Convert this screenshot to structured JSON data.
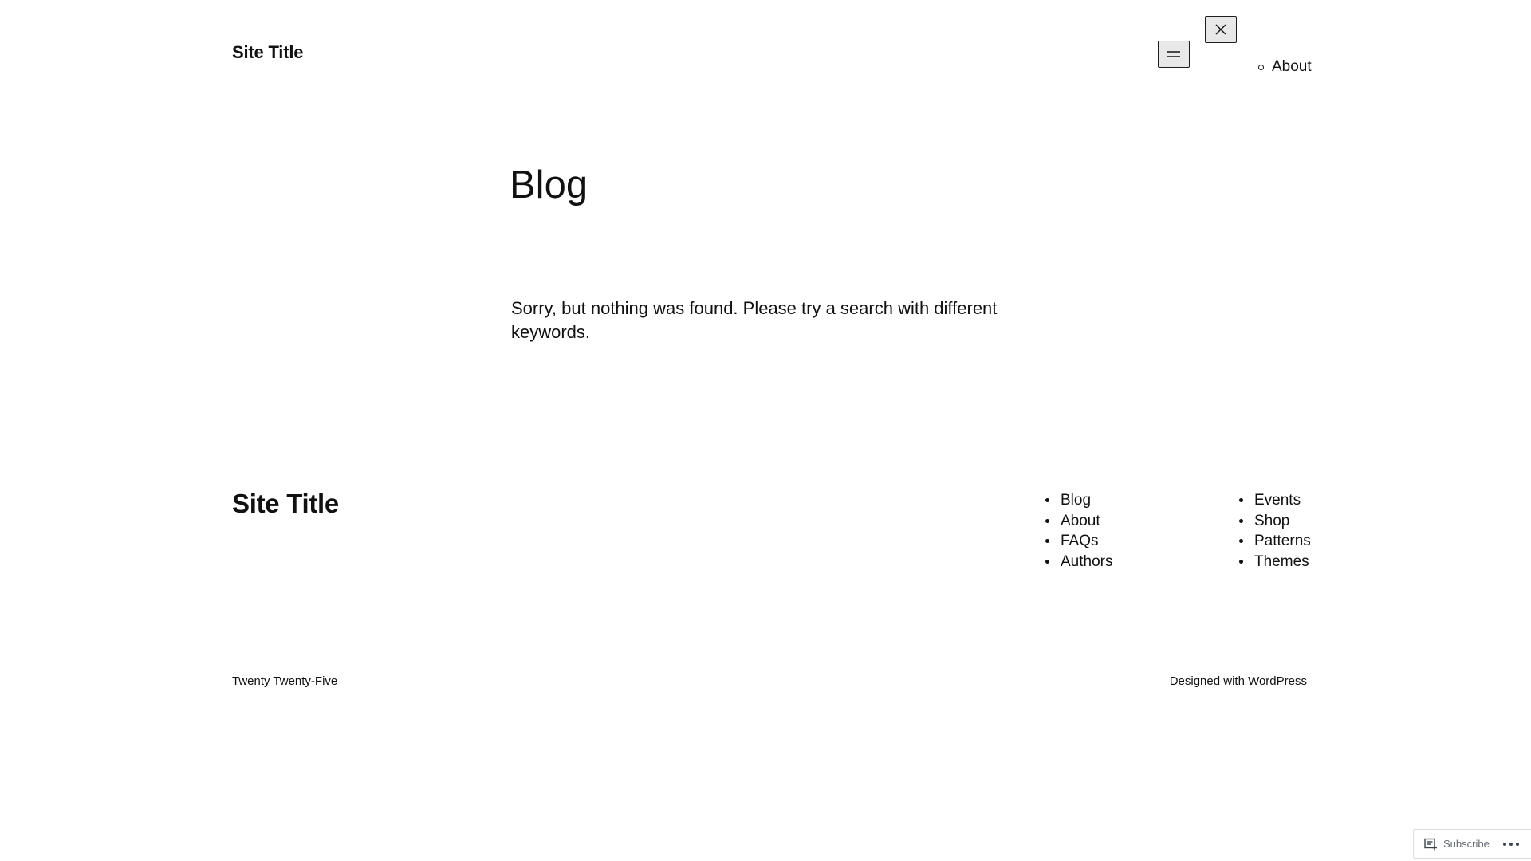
{
  "header": {
    "site_title": "Site Title",
    "nav_items": [
      "About"
    ]
  },
  "main": {
    "heading": "Blog",
    "message": "Sorry, but nothing was found. Please try a search with different keywords."
  },
  "footer": {
    "site_title": "Site Title",
    "nav_column_1": [
      "Blog",
      "About",
      "FAQs",
      "Authors"
    ],
    "nav_column_2": [
      "Events",
      "Shop",
      "Patterns",
      "Themes"
    ],
    "theme_name": "Twenty Twenty-Five",
    "credit_prefix": "Designed with",
    "credit_link": "WordPress"
  },
  "subscribe_widget": {
    "label": "Subscribe"
  },
  "icons": {
    "menu": "menu-icon",
    "close": "close-icon",
    "subscribe": "reader-icon",
    "more": "ellipsis-icon"
  }
}
